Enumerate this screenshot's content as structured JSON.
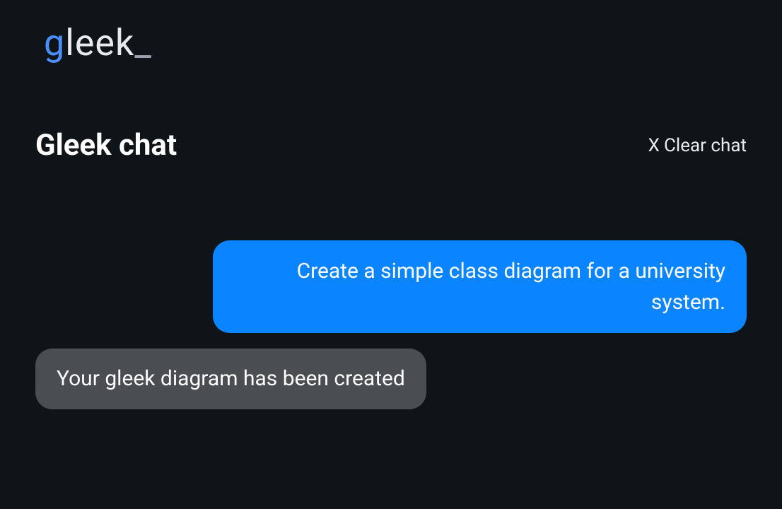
{
  "logo": {
    "g": "g",
    "rest": "leek",
    "underscore": "_"
  },
  "header": {
    "title": "Gleek chat",
    "clear_x": "X",
    "clear_label": "Clear chat"
  },
  "messages": {
    "user": "Create a simple class diagram for a university system.",
    "assistant": "Your gleek diagram has been created"
  },
  "colors": {
    "background": "#0f1419",
    "accent_blue": "#0b84ff",
    "logo_blue": "#4d8eff",
    "message_gray": "#4a4d52"
  }
}
